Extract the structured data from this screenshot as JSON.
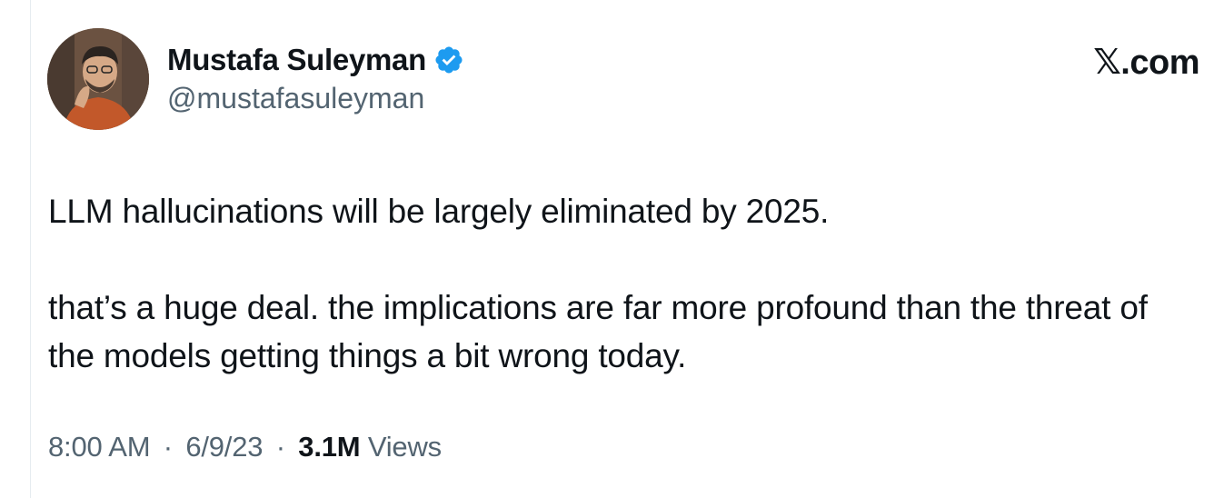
{
  "author": {
    "display_name": "Mustafa Suleyman",
    "handle": "@mustafasuleyman",
    "verified": true,
    "verified_color": "#1d9bf0"
  },
  "brand": "𝕏.com",
  "tweet": {
    "paragraphs": [
      "LLM hallucinations will be largely eliminated by 2025.",
      "that’s a huge deal. the implications are far more profound than the threat of the models getting things a bit wrong today."
    ]
  },
  "meta": {
    "time": "8:00 AM",
    "separator": "·",
    "date": "6/9/23",
    "view_count": "3.1M",
    "views_label": "Views"
  }
}
